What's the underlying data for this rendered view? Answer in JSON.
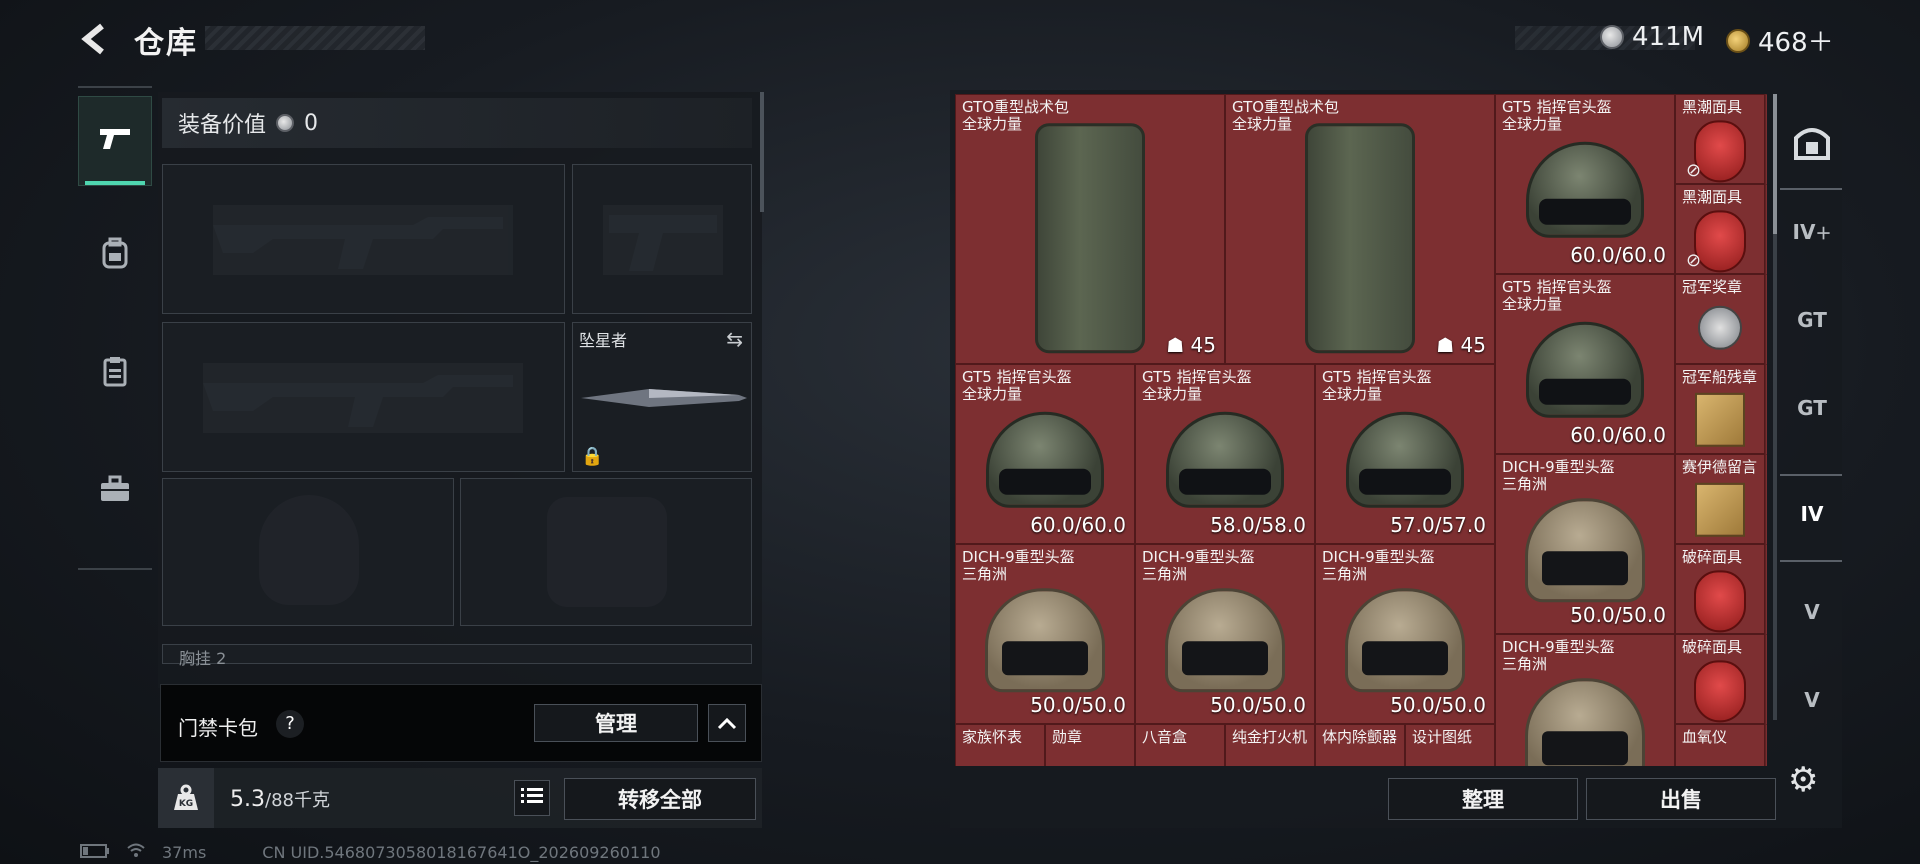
{
  "header": {
    "title": "仓库",
    "currency_silver": "411M",
    "currency_gold": "468＋"
  },
  "left_nav": {
    "items": [
      {
        "icon": "pistol-icon",
        "active": true
      },
      {
        "icon": "backpack-icon",
        "active": false
      },
      {
        "icon": "clipboard-icon",
        "active": false
      },
      {
        "icon": "briefcase-icon",
        "active": false
      }
    ]
  },
  "equipment": {
    "value_label": "装备价值",
    "value": "0",
    "melee_slot_name": "坠星者",
    "chest_rig_label": "胸挂",
    "chest_rig_count": "2"
  },
  "keycard": {
    "label": "门禁卡包",
    "help": "?",
    "manage_label": "管理"
  },
  "footer": {
    "kg_label": "KG",
    "weight_current": "5.3",
    "weight_max": "/88千克",
    "transfer_all_label": "转移全部"
  },
  "inventory": {
    "items": [
      {
        "name": "GTO重型战术包",
        "sub": "全球力量",
        "count": "45",
        "kind": "pack"
      },
      {
        "name": "GTO重型战术包",
        "sub": "全球力量",
        "count": "45",
        "kind": "pack"
      },
      {
        "name": "GT5 指挥官头盔",
        "sub": "全球力量",
        "durability": "60.0/60.0",
        "kind": "helmet-g"
      },
      {
        "name": "黑潮面具",
        "kind": "mask"
      },
      {
        "name": "黑潮面具",
        "kind": "mask"
      },
      {
        "name": "GT5 指挥官头盔",
        "sub": "全球力量",
        "durability": "60.0/60.0",
        "kind": "helmet-g"
      },
      {
        "name": "冠军奖章",
        "kind": "medal"
      },
      {
        "name": "冠军船残章",
        "kind": "paper"
      },
      {
        "name": "GT5 指挥官头盔",
        "sub": "全球力量",
        "durability": "60.0/60.0",
        "kind": "helmet-g"
      },
      {
        "name": "GT5 指挥官头盔",
        "sub": "全球力量",
        "durability": "58.0/58.0",
        "kind": "helmet-g"
      },
      {
        "name": "GT5 指挥官头盔",
        "sub": "全球力量",
        "durability": "57.0/57.0",
        "kind": "helmet-g"
      },
      {
        "name": "DICH-9重型头盔",
        "sub": "三角洲",
        "durability": "50.0/50.0",
        "kind": "helmet-t"
      },
      {
        "name": "赛伊德留言",
        "kind": "paper"
      },
      {
        "name": "DICH-9重型头盔",
        "sub": "三角洲",
        "durability": "50.0/50.0",
        "kind": "helmet-t"
      },
      {
        "name": "DICH-9重型头盔",
        "sub": "三角洲",
        "durability": "50.0/50.0",
        "kind": "helmet-t"
      },
      {
        "name": "DICH-9重型头盔",
        "sub": "三角洲",
        "durability": "50.0/50.0",
        "kind": "helmet-t"
      },
      {
        "name": "破碎面具",
        "kind": "mask"
      },
      {
        "name": "DICH-9重型头盔",
        "sub": "三角洲",
        "kind": "helmet-t"
      },
      {
        "name": "破碎面具",
        "kind": "mask"
      },
      {
        "name": "家族怀表"
      },
      {
        "name": "勋章"
      },
      {
        "name": "八音盒"
      },
      {
        "name": "纯金打火机"
      },
      {
        "name": "体内除颤器"
      },
      {
        "name": "设计图纸"
      },
      {
        "name": "血氧仪"
      }
    ]
  },
  "actions": {
    "sort_label": "整理",
    "sell_label": "出售"
  },
  "right_rail": {
    "items": [
      "IV",
      "GT",
      "GT",
      "IV",
      "V",
      "V"
    ]
  },
  "status_bar": {
    "ping": "37ms",
    "uid": "CN UID.5468073058018167641O_202609260110"
  }
}
